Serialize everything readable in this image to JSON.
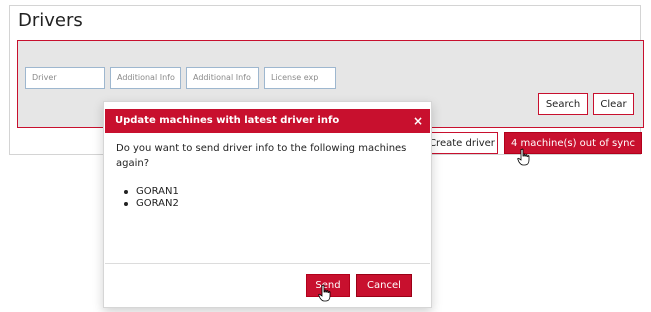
{
  "page": {
    "title": "Drivers"
  },
  "filters": {
    "driver_placeholder": "Driver",
    "additional_info_1_placeholder": "Additional Info",
    "additional_info_2_placeholder": "Additional Info",
    "license_exp_placeholder": "License exp"
  },
  "actions": {
    "search": "Search",
    "clear": "Clear",
    "create_driver": "Create driver",
    "out_of_sync": "4 machine(s) out of sync"
  },
  "modal": {
    "title": "Update machines with latest driver info",
    "close_icon": "×",
    "message": "Do you want to send driver info to the following machines again?",
    "machines": [
      "GORAN1",
      "GORAN2"
    ],
    "send": "Send",
    "cancel": "Cancel"
  },
  "colors": {
    "accent": "#c8102e",
    "accent_dark": "#b3001b",
    "panel_bg": "#e6e6e6",
    "input_border": "#9eb7cf"
  },
  "icons": {
    "pointer": "hand-pointer-icon",
    "close": "close-icon",
    "bullet": "bullet-icon"
  }
}
